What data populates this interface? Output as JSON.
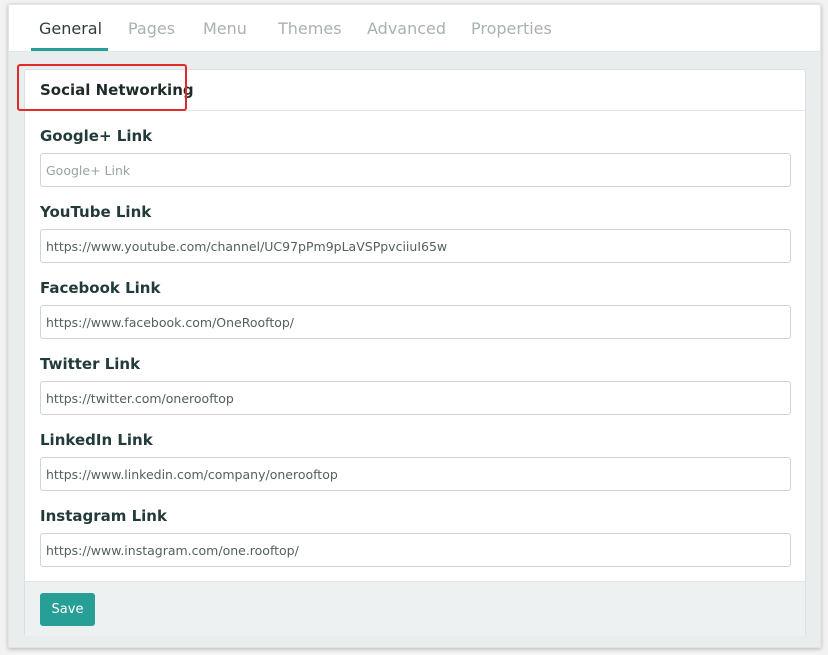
{
  "tabs": [
    {
      "label": "General"
    },
    {
      "label": "Pages"
    },
    {
      "label": "Menu"
    },
    {
      "label": "Themes"
    },
    {
      "label": "Advanced"
    },
    {
      "label": "Properties"
    }
  ],
  "active_tab": "General",
  "section": {
    "title": "Social Networking"
  },
  "fields": [
    {
      "label": "Google+ Link",
      "value": "",
      "placeholder": "Google+ Link"
    },
    {
      "label": "YouTube Link",
      "value": "https://www.youtube.com/channel/UC97pPm9pLaVSPpvciiuI65w",
      "placeholder": ""
    },
    {
      "label": "Facebook Link",
      "value": "https://www.facebook.com/OneRooftop/",
      "placeholder": ""
    },
    {
      "label": "Twitter Link",
      "value": "https://twitter.com/onerooftop",
      "placeholder": ""
    },
    {
      "label": "LinkedIn Link",
      "value": "https://www.linkedin.com/company/onerooftop",
      "placeholder": ""
    },
    {
      "label": "Instagram Link",
      "value": "https://www.instagram.com/one.rooftop/",
      "placeholder": ""
    }
  ],
  "footer": {
    "save_label": "Save"
  },
  "colors": {
    "accent": "#279e96",
    "highlight": "#e12b2b",
    "panel_background": "#e9eded"
  }
}
